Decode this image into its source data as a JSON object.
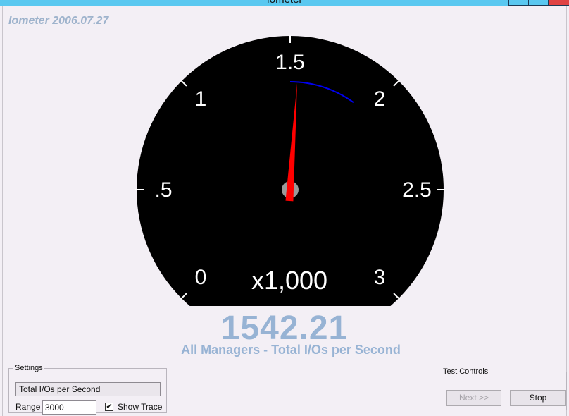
{
  "window": {
    "title": "Iometer"
  },
  "app_version": "Iometer 2006.07.27",
  "gauge": {
    "tick_labels": [
      "0",
      ".5",
      "1",
      "1.5",
      "2",
      "2.5",
      "3"
    ],
    "multiplier": "x1,000",
    "needle_value": 1542.21,
    "trace_min": 1500,
    "trace_max": 1900,
    "range": 3000,
    "needle_color": "#ff0000",
    "trace_color": "#0000ee"
  },
  "reading": {
    "value": "1542.21",
    "label": "All Managers - Total I/Os per Second"
  },
  "settings": {
    "legend": "Settings",
    "metric": "Total I/Os per Second",
    "range_label": "Range",
    "range_value": "3000",
    "show_trace_label": "Show Trace",
    "show_trace_checked": "✔"
  },
  "test_controls": {
    "legend": "Test Controls",
    "next_label": "Next >>",
    "stop_label": "Stop"
  }
}
